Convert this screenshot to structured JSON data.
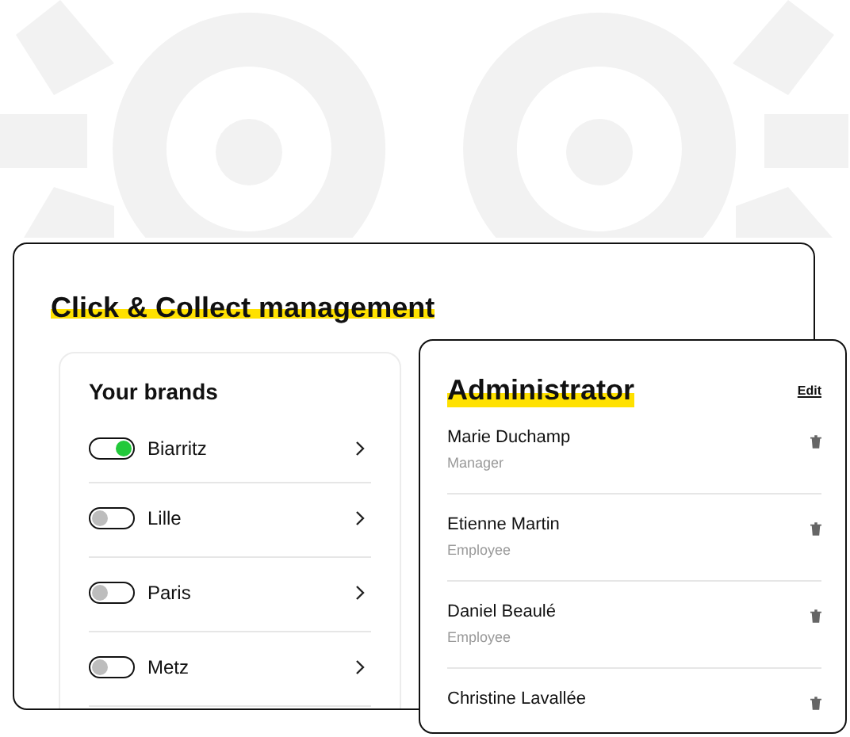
{
  "main_card": {
    "title": "Click & Collect management",
    "brands": {
      "heading": "Your brands",
      "items": [
        {
          "name": "Biarritz",
          "on": true
        },
        {
          "name": "Lille",
          "on": false
        },
        {
          "name": "Paris",
          "on": false
        },
        {
          "name": "Metz",
          "on": false
        }
      ]
    }
  },
  "administrator": {
    "title": "Administrator",
    "edit": "Edit",
    "people": [
      {
        "name": "Marie Duchamp",
        "role": "Manager"
      },
      {
        "name": "Etienne Martin",
        "role": "Employee"
      },
      {
        "name": "Daniel Beaulé",
        "role": "Employee"
      },
      {
        "name": "Christine Lavallée"
      }
    ]
  }
}
